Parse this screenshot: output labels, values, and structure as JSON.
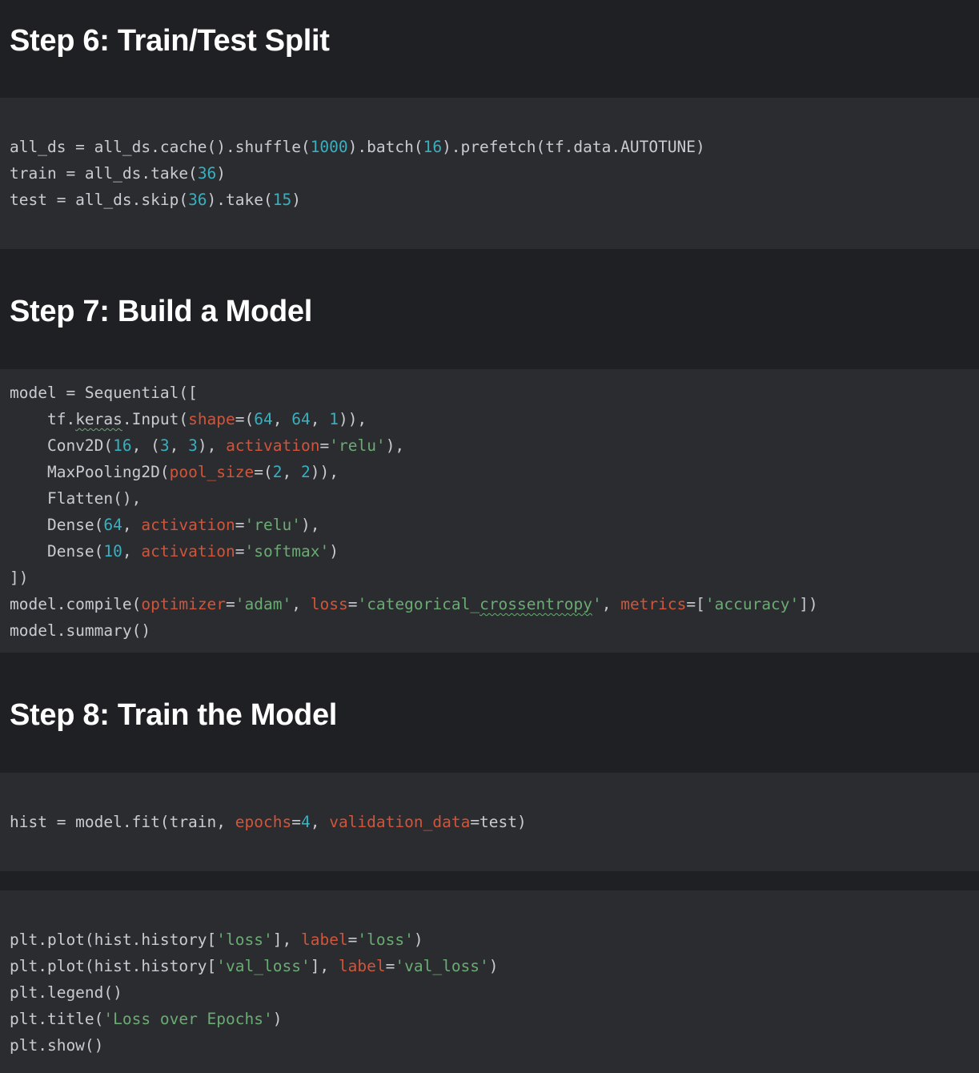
{
  "colors": {
    "page_bg": "#1f2023",
    "code_bg": "#2b2c30",
    "heading": "#ffffff",
    "code_default": "#c9cbd0",
    "number": "#37b0c0",
    "keyword_arg": "#d0553a",
    "string": "#6aab73"
  },
  "cells": [
    {
      "kind": "markdown",
      "heading": "Step 6: Train/Test Split"
    },
    {
      "kind": "code",
      "lines": [
        [
          [
            "p",
            "all_ds = all_ds.cache().shuffle("
          ],
          [
            "n",
            "1000"
          ],
          [
            "p",
            ").batch("
          ],
          [
            "n",
            "16"
          ],
          [
            "p",
            ").prefetch(tf.data.AUTOTUNE)"
          ]
        ],
        [
          [
            "p",
            "train = all_ds.take("
          ],
          [
            "n",
            "36"
          ],
          [
            "p",
            ")"
          ]
        ],
        [
          [
            "p",
            "test = all_ds.skip("
          ],
          [
            "n",
            "36"
          ],
          [
            "p",
            ").take("
          ],
          [
            "n",
            "15"
          ],
          [
            "p",
            ")"
          ]
        ]
      ]
    },
    {
      "kind": "markdown",
      "heading": "Step 7: Build a Model"
    },
    {
      "kind": "code",
      "lines": [
        [
          [
            "p",
            "model = Sequential(["
          ]
        ],
        [
          [
            "p",
            "    tf."
          ],
          [
            "q",
            "keras"
          ],
          [
            "p",
            ".Input("
          ],
          [
            "k",
            "shape"
          ],
          [
            "p",
            "=("
          ],
          [
            "n",
            "64"
          ],
          [
            "p",
            ", "
          ],
          [
            "n",
            "64"
          ],
          [
            "p",
            ", "
          ],
          [
            "n",
            "1"
          ],
          [
            "p",
            ")),"
          ]
        ],
        [
          [
            "p",
            "    Conv2D("
          ],
          [
            "n",
            "16"
          ],
          [
            "p",
            ", ("
          ],
          [
            "n",
            "3"
          ],
          [
            "p",
            ", "
          ],
          [
            "n",
            "3"
          ],
          [
            "p",
            "), "
          ],
          [
            "k",
            "activation"
          ],
          [
            "p",
            "="
          ],
          [
            "s",
            "'relu'"
          ],
          [
            "p",
            "),"
          ]
        ],
        [
          [
            "p",
            "    MaxPooling2D("
          ],
          [
            "k",
            "pool_size"
          ],
          [
            "p",
            "=("
          ],
          [
            "n",
            "2"
          ],
          [
            "p",
            ", "
          ],
          [
            "n",
            "2"
          ],
          [
            "p",
            ")),"
          ]
        ],
        [
          [
            "p",
            "    Flatten(),"
          ]
        ],
        [
          [
            "p",
            "    Dense("
          ],
          [
            "n",
            "64"
          ],
          [
            "p",
            ", "
          ],
          [
            "k",
            "activation"
          ],
          [
            "p",
            "="
          ],
          [
            "s",
            "'relu'"
          ],
          [
            "p",
            "),"
          ]
        ],
        [
          [
            "p",
            "    Dense("
          ],
          [
            "n",
            "10"
          ],
          [
            "p",
            ", "
          ],
          [
            "k",
            "activation"
          ],
          [
            "p",
            "="
          ],
          [
            "s",
            "'softmax'"
          ],
          [
            "p",
            ")"
          ]
        ],
        [
          [
            "p",
            "])"
          ]
        ],
        [
          [
            "p",
            "model.compile("
          ],
          [
            "k",
            "optimizer"
          ],
          [
            "p",
            "="
          ],
          [
            "s",
            "'adam'"
          ],
          [
            "p",
            ", "
          ],
          [
            "k",
            "loss"
          ],
          [
            "p",
            "="
          ],
          [
            "s",
            "'categorical_"
          ],
          [
            "sq",
            "crossentropy"
          ],
          [
            "s",
            "'"
          ],
          [
            "p",
            ", "
          ],
          [
            "k",
            "metrics"
          ],
          [
            "p",
            "=["
          ],
          [
            "s",
            "'accuracy'"
          ],
          [
            "p",
            "])"
          ]
        ],
        [
          [
            "p",
            "model.summary()"
          ]
        ]
      ]
    },
    {
      "kind": "markdown",
      "heading": "Step 8: Train the Model"
    },
    {
      "kind": "code",
      "lines": [
        [
          [
            "p",
            "hist = model.fit(train, "
          ],
          [
            "k",
            "epochs"
          ],
          [
            "p",
            "="
          ],
          [
            "n",
            "4"
          ],
          [
            "p",
            ", "
          ],
          [
            "k",
            "validation_data"
          ],
          [
            "p",
            "=test)"
          ]
        ]
      ]
    },
    {
      "kind": "code",
      "lines": [
        [
          [
            "p",
            "plt.plot(hist.history["
          ],
          [
            "s",
            "'loss'"
          ],
          [
            "p",
            "], "
          ],
          [
            "k",
            "label"
          ],
          [
            "p",
            "="
          ],
          [
            "s",
            "'loss'"
          ],
          [
            "p",
            ")"
          ]
        ],
        [
          [
            "p",
            "plt.plot(hist.history["
          ],
          [
            "s",
            "'val_loss'"
          ],
          [
            "p",
            "], "
          ],
          [
            "k",
            "label"
          ],
          [
            "p",
            "="
          ],
          [
            "s",
            "'val_loss'"
          ],
          [
            "p",
            ")"
          ]
        ],
        [
          [
            "p",
            "plt.legend()"
          ]
        ],
        [
          [
            "p",
            "plt.title("
          ],
          [
            "s",
            "'Loss over Epochs'"
          ],
          [
            "p",
            ")"
          ]
        ],
        [
          [
            "p",
            "plt.show()"
          ]
        ]
      ]
    }
  ]
}
